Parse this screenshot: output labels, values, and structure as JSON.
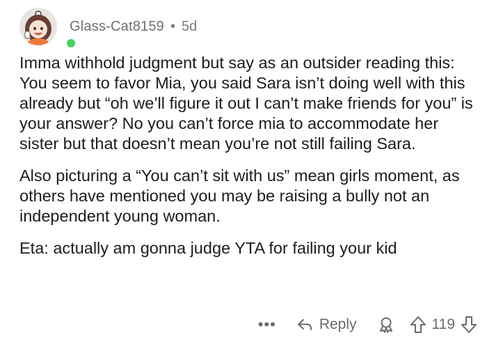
{
  "comment": {
    "username": "Glass-Cat8159",
    "separator": "•",
    "age": "5d",
    "paragraphs": [
      "Imma withhold judgment but say as an outsider reading this: You seem to favor Mia, you said Sara isn’t doing well with this already but “oh we’ll figure it out I can’t make friends for you” is your answer? No you can’t force mia to accommodate her sister but that doesn’t mean you’re not still failing Sara.",
      "Also picturing a “You can’t sit with us” mean girls moment, as others have mentioned you may be raising a bully not an independent young woman.",
      "Eta: actually am gonna judge YTA for failing your kid"
    ]
  },
  "actions": {
    "more_label": "•••",
    "reply_label": "Reply",
    "score": "119"
  },
  "icons": {
    "more": "more-icon",
    "reply": "reply-arrow-icon",
    "award": "award-icon",
    "upvote": "upvote-arrow-icon",
    "downvote": "downvote-arrow-icon"
  },
  "colors": {
    "online": "#46d160",
    "meta": "#7c7c7c",
    "text": "#1c1c1c"
  }
}
